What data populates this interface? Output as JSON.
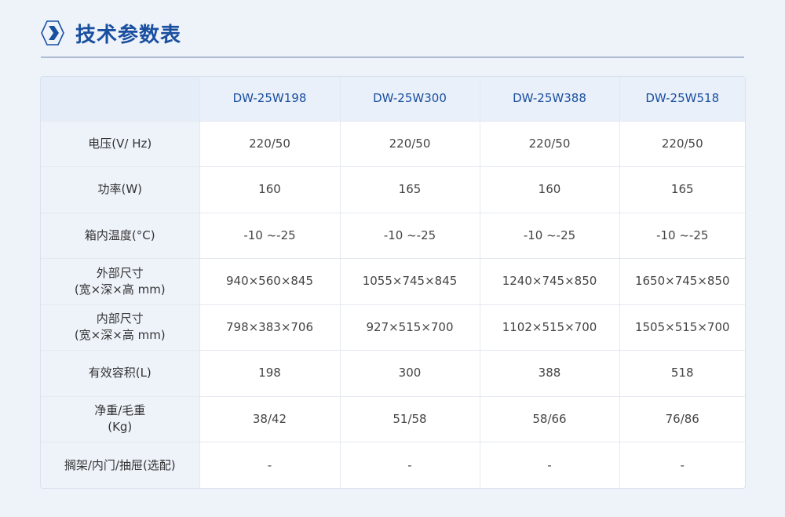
{
  "header": {
    "title": "技术参数表",
    "accent_color": "#1a4fa0",
    "icon": "chevron-right-icon"
  },
  "table": {
    "columns": [
      "",
      "DW-25W198",
      "DW-25W300",
      "DW-25W388",
      "DW-25W518"
    ],
    "rows": [
      {
        "label": [
          "电压(V/ Hz)"
        ],
        "values": [
          "220/50",
          "220/50",
          "220/50",
          "220/50"
        ]
      },
      {
        "label": [
          "功率(W)"
        ],
        "values": [
          "160",
          "165",
          "160",
          "165"
        ]
      },
      {
        "label": [
          "箱内温度(°C)"
        ],
        "values": [
          "-10 ~-25",
          "-10 ~-25",
          "-10 ~-25",
          "-10 ~-25"
        ]
      },
      {
        "label": [
          "外部尺寸",
          "(宽×深×高 mm)"
        ],
        "values": [
          "940×560×845",
          "1055×745×845",
          "1240×745×850",
          "1650×745×850"
        ]
      },
      {
        "label": [
          "内部尺寸",
          "(宽×深×高 mm)"
        ],
        "values": [
          "798×383×706",
          "927×515×700",
          "1102×515×700",
          "1505×515×700"
        ]
      },
      {
        "label": [
          "有效容积(L)"
        ],
        "values": [
          "198",
          "300",
          "388",
          "518"
        ]
      },
      {
        "label": [
          "净重/毛重",
          "(Kg)"
        ],
        "values": [
          "38/42",
          "51/58",
          "58/66",
          "76/86"
        ]
      },
      {
        "label": [
          "搁架/内门/抽屉(选配)"
        ],
        "values": [
          "-",
          "-",
          "-",
          "-"
        ]
      }
    ]
  }
}
